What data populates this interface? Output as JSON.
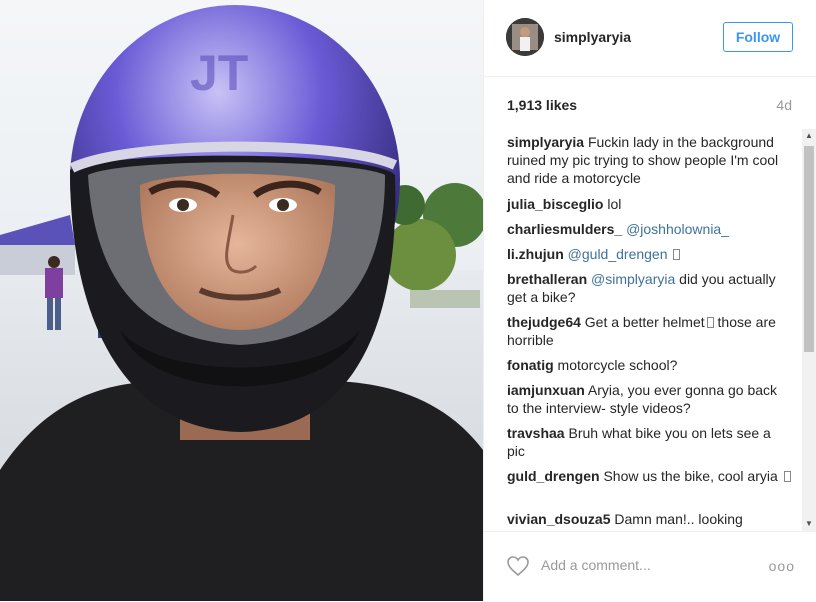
{
  "post": {
    "username": "simplyaryia",
    "follow_label": "Follow",
    "likes": "1,913 likes",
    "age": "4d"
  },
  "comments": [
    {
      "user": "simplyaryia",
      "text": "Fuckin lady in the background ruined my pic trying to show people I'm cool and ride a motorcycle"
    },
    {
      "user": "julia_bisceglio",
      "text": "lol"
    },
    {
      "user": "charliesmulders_",
      "mention": "@joshholownia_"
    },
    {
      "user": "li.zhujun",
      "mention": "@guld_drengen"
    },
    {
      "user": "brethalleran",
      "mention": "@simplyaryia",
      "text": "did you actually get a bike?"
    },
    {
      "user": "thejudge64",
      "text": "Get a better helmet",
      "text2": "those are horrible"
    },
    {
      "user": "fonatig",
      "text": "motorcycle school?"
    },
    {
      "user": "iamjunxuan",
      "text": "Aryia, you ever gonna go back to the interview- style videos?"
    },
    {
      "user": "travshaa",
      "text": "Bruh what bike you on lets see a pic"
    },
    {
      "user": "guld_drengen",
      "text": "Show us the bike, cool aryia"
    },
    {
      "user": "vivian_dsouza5",
      "text": "Damn man!.. looking"
    }
  ],
  "footer": {
    "add_comment_placeholder": "Add a comment...",
    "more_label": "ooo"
  },
  "icons": {
    "like": "heart-icon",
    "more": "more-options-icon",
    "avatar": "avatar"
  },
  "colors": {
    "link": "#3897f0",
    "mention": "#3f729b",
    "muted": "#999999",
    "text": "#262626"
  }
}
